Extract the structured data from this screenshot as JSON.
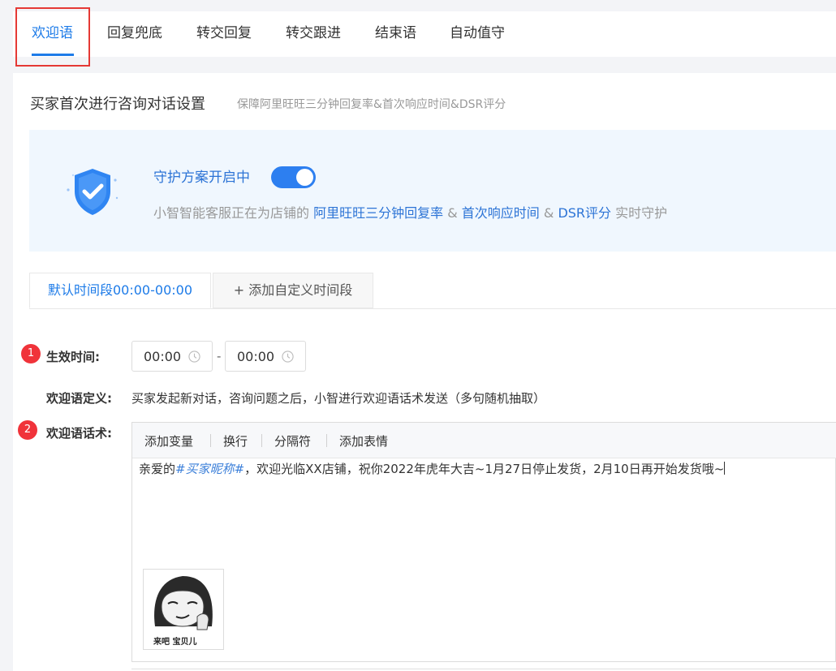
{
  "tabs": [
    {
      "label": "欢迎语",
      "active": true
    },
    {
      "label": "回复兜底"
    },
    {
      "label": "转交回复"
    },
    {
      "label": "转交跟进"
    },
    {
      "label": "结束语"
    },
    {
      "label": "自动值守"
    }
  ],
  "panel": {
    "title": "买家首次进行咨询对话设置",
    "subtitle": "保障阿里旺旺三分钟回复率&首次响应时间&DSR评分"
  },
  "banner": {
    "title": "守护方案开启中",
    "toggle_on": true,
    "desc_prefix": "小智智能客服正在为店铺的 ",
    "metric1": "阿里旺旺三分钟回复率",
    "amp1": " & ",
    "metric2": "首次响应时间",
    "amp2": " & ",
    "metric3": "DSR评分",
    "desc_suffix": " 实时守护",
    "icon": "shield-check-icon"
  },
  "time_tabs": {
    "default_label": "默认时间段00:00-00:00",
    "add_label": "+ 添加自定义时间段"
  },
  "form": {
    "badge1": "1",
    "badge2": "2",
    "effective_label": "生效时间:",
    "start_time": "00:00",
    "separator": "-",
    "end_time": "00:00",
    "definition_label": "欢迎语定义:",
    "definition_text": "买家发起新对话，咨询问题之后，小智进行欢迎语话术发送（多句随机抽取）",
    "script_label": "欢迎语话术:"
  },
  "editor": {
    "toolbar": [
      "添加变量",
      "换行",
      "分隔符",
      "添加表情"
    ],
    "text_prefix": "亲爱的",
    "variable": "#买家昵称#",
    "text_suffix": "，欢迎光临XX店铺，祝你2022年虎年大吉~1月27日停止发货，2月10日再开始发货哦~",
    "sticker_caption": "来吧 宝贝儿"
  },
  "colors": {
    "accent": "#1d7be8",
    "badge": "#f0333a",
    "highlight_border": "#e53935",
    "banner_bg": "#f0f7fe"
  }
}
